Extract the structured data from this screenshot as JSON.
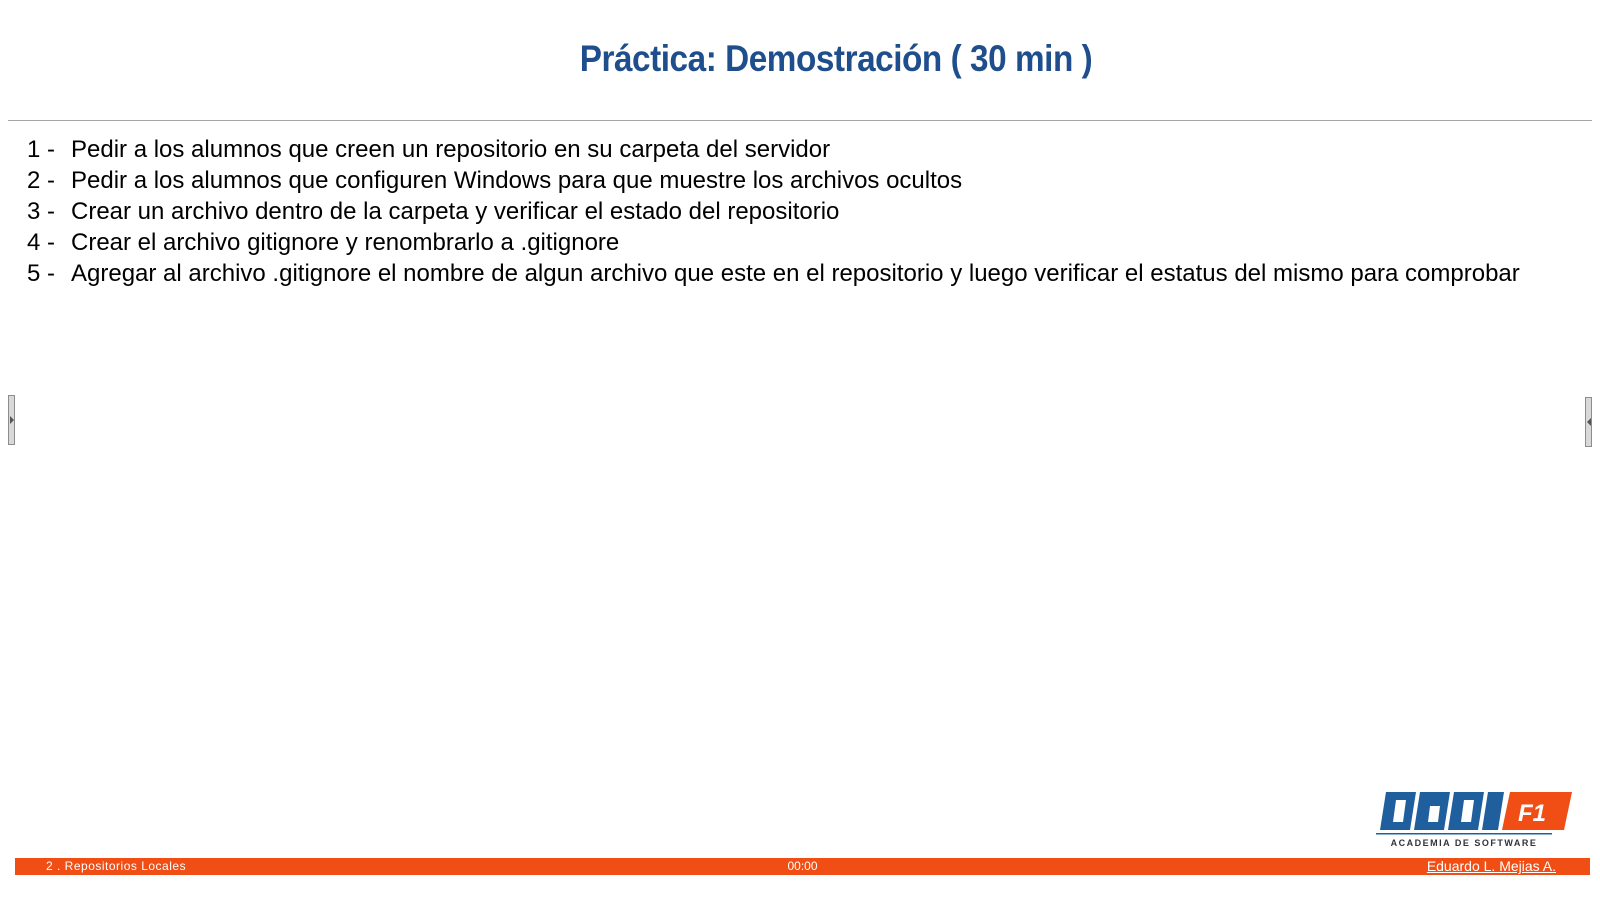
{
  "slide": {
    "title": "Práctica: Demostración ( 30 min )",
    "items": [
      {
        "num": "1 -",
        "text": "Pedir a los alumnos que creen un repositorio en su carpeta del servidor"
      },
      {
        "num": "2 -",
        "text": "Pedir a los alumnos que configuren Windows para que muestre los archivos ocultos"
      },
      {
        "num": "3 -",
        "text": "Crear un archivo dentro de la carpeta y verificar el estado del repositorio"
      },
      {
        "num": "4 -",
        "text": "Crear el archivo gitignore y renombrarlo a .gitignore"
      },
      {
        "num": "5 -",
        "text": "Agregar al archivo .gitignore el nombre de algun archivo que este en el repositorio y luego verificar el estatus del mismo para comprobar"
      }
    ]
  },
  "logo": {
    "brand": "CAPI",
    "badge": "F1",
    "tagline": "ACADEMIA DE SOFTWARE"
  },
  "footer": {
    "section": "2 . Repositorios Locales",
    "time": "00:00",
    "author": "Eduardo L. Mejias A."
  },
  "colors": {
    "title": "#1f4e8c",
    "footer_bar": "#f04e14",
    "logo_blue": "#1f5f9e",
    "logo_orange": "#f04e14"
  },
  "icons": {
    "left_handle": "collapse-left-handle-icon",
    "right_handle": "collapse-right-handle-icon"
  }
}
